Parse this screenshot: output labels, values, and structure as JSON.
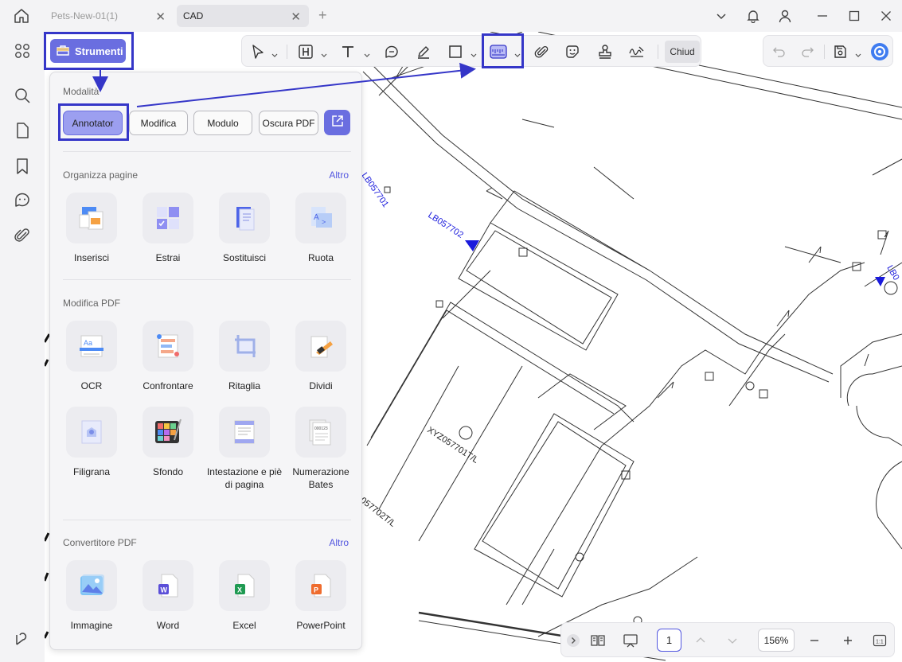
{
  "tabs": [
    {
      "label": "Pets-New-01(1)"
    },
    {
      "label": "CAD"
    }
  ],
  "toolbar": {
    "close_label": "Chiud",
    "tools": [
      "cursor-icon",
      "highlight-icon",
      "text-icon",
      "comment-icon",
      "pen-icon",
      "shape-icon",
      "ruler-icon",
      "attach-icon",
      "sticker-icon",
      "stamp-icon",
      "signature-icon"
    ]
  },
  "strumenti": {
    "label": "Strumenti"
  },
  "panel": {
    "modes_title": "Modalità",
    "modes": [
      "Annotator",
      "Modifica",
      "Modulo",
      "Oscura PDF"
    ],
    "sections": [
      {
        "title": "Organizza pagine",
        "more": "Altro",
        "items": [
          "Inserisci",
          "Estrai",
          "Sostituisci",
          "Ruota"
        ]
      },
      {
        "title": "Modifica PDF",
        "more": "",
        "items": [
          "OCR",
          "Confrontare",
          "Ritaglia",
          "Dividi",
          "Filigrana",
          "Sfondo",
          "Intestazione e piè di pagina",
          "Numerazione Bates"
        ]
      },
      {
        "title": "Convertitore PDF",
        "more": "Altro",
        "items": [
          "Immagine",
          "Word",
          "Excel",
          "PowerPoint"
        ]
      }
    ]
  },
  "cad": {
    "labels": [
      "LB057701",
      "LB057702",
      "XYZ057701T/L",
      "057702T/L",
      "LB0"
    ]
  },
  "bottom": {
    "page": "1",
    "zoom": "156%"
  },
  "colors": {
    "accent": "#6a6ee0",
    "annotation": "#3536c8",
    "cad_label": "#1a1adc"
  }
}
